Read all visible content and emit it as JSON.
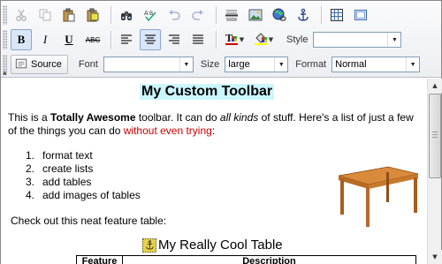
{
  "toolbar": {
    "row1": {
      "cut": "cut-icon",
      "copy": "copy-icon",
      "paste": "paste-icon",
      "paste_text": "paste-text-icon",
      "find": "binoculars-icon",
      "spellcheck": "spellcheck-icon",
      "undo": "undo-icon",
      "redo": "redo-icon",
      "hr": "horizontal-rule-icon",
      "image": "image-icon",
      "link": "hyperlink-globe-icon",
      "anchor": "anchor-icon",
      "table": "table-icon",
      "form": "form-icon"
    },
    "row2": {
      "bold_label": "B",
      "italic_label": "I",
      "underline_label": "U",
      "strike_label": "ABC",
      "style_label": "Style",
      "style_value": ""
    },
    "row3": {
      "source_label": "Source",
      "font_label": "Font",
      "font_value": "",
      "size_label": "Size",
      "size_value": "large",
      "format_label": "Format",
      "format_value": "Normal"
    }
  },
  "document": {
    "title": "My Custom Toolbar",
    "para_1a": "This is a ",
    "para_1b": "Totally Awesome",
    "para_1c": " toolbar. It can do ",
    "para_1d": "all kinds",
    "para_1e": " of stuff. Here's a list of just a few of the things you can do ",
    "para_1f": "without even trying",
    "para_1g": ":",
    "list": [
      {
        "num": "1.",
        "text": "format text"
      },
      {
        "num": "2.",
        "text": "create lists"
      },
      {
        "num": "3.",
        "text": "add tables"
      },
      {
        "num": "4.",
        "text": "add images of tables"
      }
    ],
    "feature_note": "Check out this neat feature table:",
    "table_caption": "My Really Cool Table",
    "table_headers": [
      "Feature",
      "Description"
    ]
  },
  "colors": {
    "title_highlight": "#ccf6ff",
    "red_text": "#cc0000",
    "active_button": "#d9e6f7"
  }
}
